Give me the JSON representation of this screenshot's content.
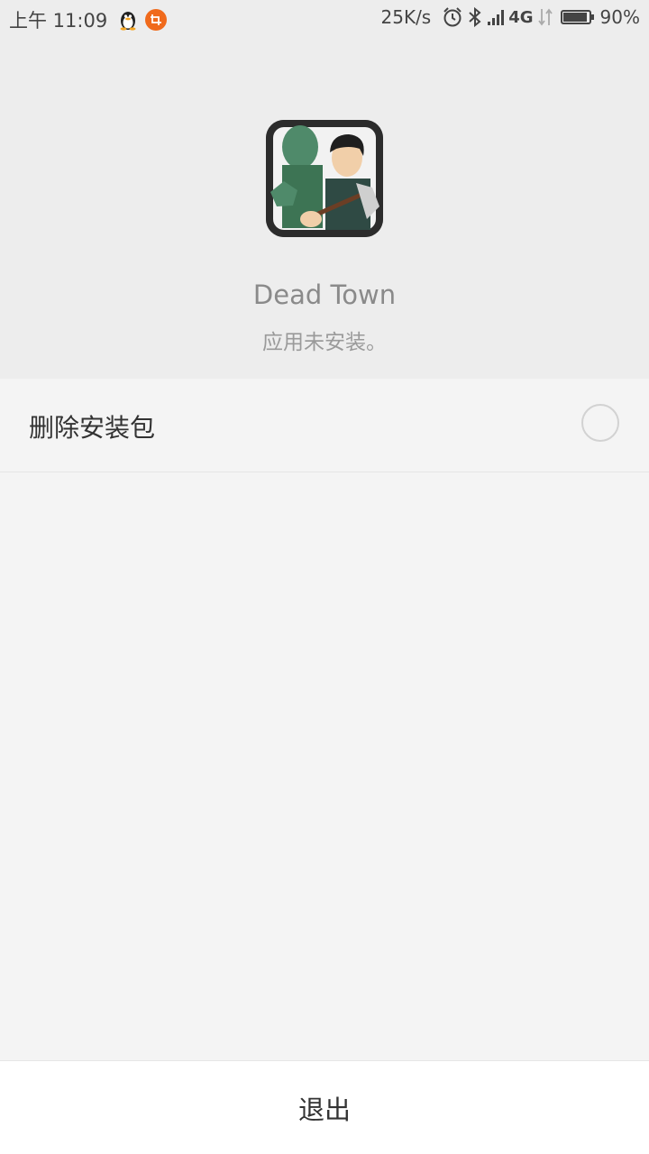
{
  "status_bar": {
    "time": "上午 11:09",
    "net_speed": "25K/s",
    "net_type": "4G",
    "battery": "90%",
    "icons": [
      "qq-icon",
      "app-notification-icon",
      "alarm-icon",
      "bluetooth-icon",
      "signal-icon",
      "data-transfer-icon",
      "battery-icon"
    ],
    "battery_level": 0.9
  },
  "app": {
    "name": "Dead Town",
    "status": "应用未安装。",
    "icon": "dead-town-app-icon"
  },
  "options": {
    "delete_package_label": "删除安装包",
    "delete_package_checked": false
  },
  "actions": {
    "exit_label": "退出"
  },
  "colors": {
    "header_bg": "#ededed",
    "body_bg": "#f4f4f4",
    "notif_orange": "#f06a1c",
    "zombie_green": "#4f8a6a"
  }
}
